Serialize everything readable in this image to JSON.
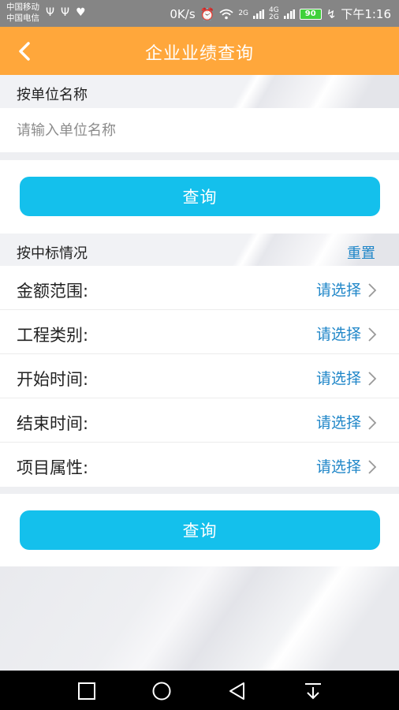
{
  "status_bar": {
    "carrier1": "中国移动",
    "carrier2": "中国电信",
    "left_icons": [
      "Ψ",
      "Ψ",
      "♥"
    ],
    "speed": "0K/s",
    "alarm": "⏰",
    "signal1": "2G",
    "signal2a": "4G",
    "signal2b": "2G",
    "battery": "90",
    "time": "下午1:16"
  },
  "header": {
    "title": "企业业绩查询"
  },
  "search_by_name": {
    "label": "按单位名称",
    "placeholder": "请输入单位名称",
    "button_label": "查询"
  },
  "filter_section": {
    "label": "按中标情况",
    "reset_label": "重置",
    "rows": [
      {
        "label": "金额范围:",
        "value": "请选择"
      },
      {
        "label": "工程类别:",
        "value": "请选择"
      },
      {
        "label": "开始时间:",
        "value": "请选择"
      },
      {
        "label": "结束时间:",
        "value": "请选择"
      },
      {
        "label": "项目属性:",
        "value": "请选择"
      }
    ],
    "button_label": "查询"
  },
  "colors": {
    "accent": "#ffa73b",
    "button": "#14c0ec",
    "link": "#1f86c8"
  }
}
